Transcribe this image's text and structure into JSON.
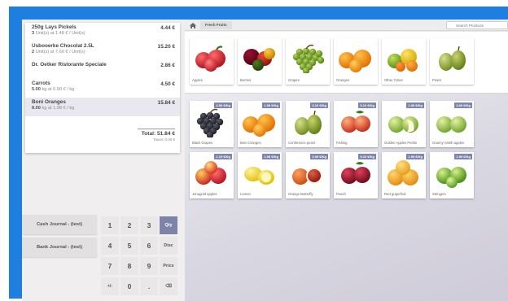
{
  "order": {
    "lines": [
      {
        "name": "250g Lays Pickels",
        "price": "4.44 €",
        "qty": "3",
        "detail": "Unit(s) at 1.48 € / Unit(s)",
        "selected": false
      },
      {
        "name": "Usbooerke Chocolat 2.5L",
        "price": "15.20 €",
        "qty": "2",
        "detail": "Unit(s) at 7.60 € / Unit(s)",
        "selected": false
      },
      {
        "name": "Dr. Oetker Ristorante Speciale",
        "price": "2.86 €",
        "qty": "",
        "detail": "",
        "selected": false
      },
      {
        "name": "Carrots",
        "price": "4.50 €",
        "qty": "5.00",
        "detail": "kg at 0.90 € / kg",
        "selected": false
      },
      {
        "name": "Boni Oranges",
        "price": "15.84 €",
        "qty": "8.00",
        "detail": "kg at 1.98 € / kg",
        "selected": true
      }
    ],
    "total": "Total: 51.84 €",
    "taxes": "Taxes: 0.00 €"
  },
  "journals": [
    "Cash Journal - (test)",
    "Bank Journal - (test)"
  ],
  "numpad": {
    "rows": [
      [
        "1",
        "2",
        "3",
        "Qty"
      ],
      [
        "4",
        "5",
        "6",
        "Disc"
      ],
      [
        "7",
        "8",
        "9",
        "Price"
      ],
      [
        "+/-",
        "0",
        ".",
        "⌫"
      ]
    ],
    "active_mode": "Qty"
  },
  "topbar": {
    "breadcrumb": "Fresh Fruits",
    "search_placeholder": "Search Products"
  },
  "categories": [
    "Apples",
    "Berries",
    "Grapes",
    "Oranges",
    "Other Citrus",
    "Pears"
  ],
  "products": [
    {
      "name": "Black Grapes",
      "price": "4.90 €/Kg",
      "kind": "grapes-black"
    },
    {
      "name": "Boni Oranges",
      "price": "1.98 €/Kg",
      "kind": "oranges"
    },
    {
      "name": "Conference pears",
      "price": "3.10 €/Kg",
      "kind": "pears"
    },
    {
      "name": "Fishing",
      "price": "5.10 €/Kg",
      "kind": "peaches"
    },
    {
      "name": "Golden Apples Perlim",
      "price": "1.99 €/Kg",
      "kind": "apples-green"
    },
    {
      "name": "Granny Smith apples",
      "price": "2.09 €/Kg",
      "kind": "apples-green2"
    },
    {
      "name": "Jonagold apples",
      "price": "1.19 €/Kg",
      "kind": "apples-red"
    },
    {
      "name": "Lemon",
      "price": "1.98 €/Kg",
      "kind": "lemons"
    },
    {
      "name": "Orange Butterfly",
      "price": "2.99 €/Kg",
      "kind": "blood-orange"
    },
    {
      "name": "Peach",
      "price": "5.10 €/Kg",
      "kind": "peach-dark"
    },
    {
      "name": "Red grapefruit",
      "price": "1.99 €/Kg",
      "kind": "grapefruit"
    },
    {
      "name": "Stringers",
      "price": "1.99 €/Kg",
      "kind": "limes"
    }
  ],
  "colors": {
    "accent": "#7e84a8",
    "screen_frame": "#1e7fe0"
  }
}
